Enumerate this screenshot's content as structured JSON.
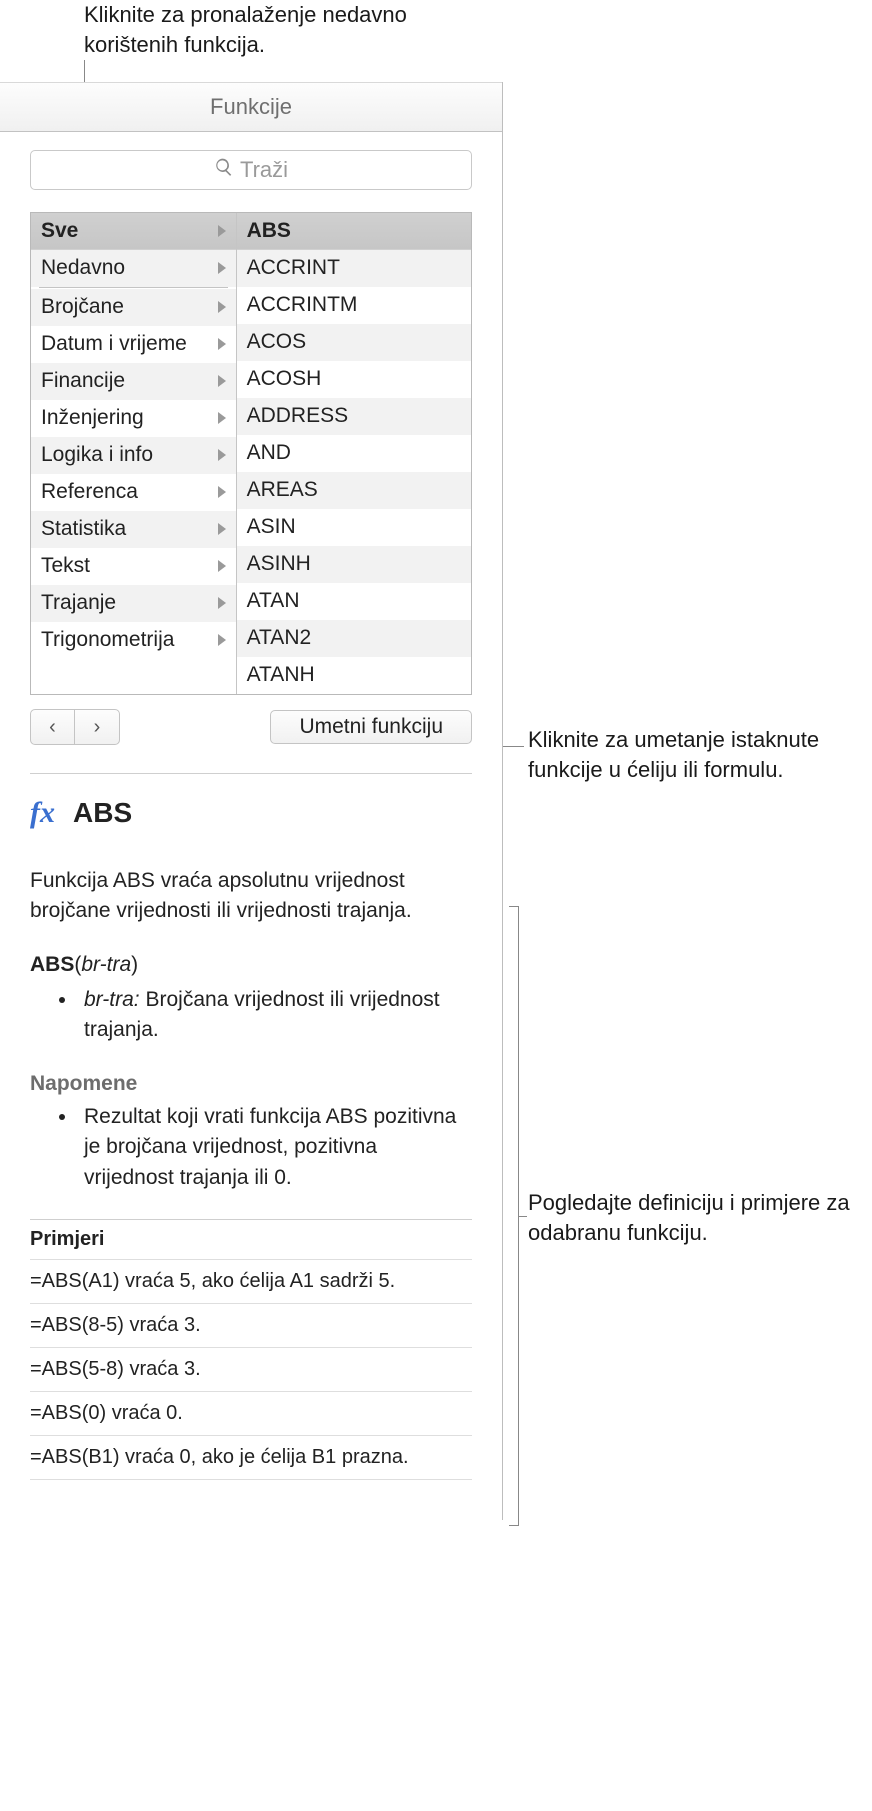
{
  "callouts": {
    "recent": "Kliknite za pronalaženje nedavno korištenih funkcija.",
    "insert": "Kliknite za umetanje istaknute funkcije u ćeliju ili formulu.",
    "definition": "Pogledajte definiciju i primjere za odabranu funkciju."
  },
  "header": {
    "title": "Funkcije"
  },
  "search": {
    "placeholder": "Traži"
  },
  "categories": [
    {
      "label": "Sve",
      "selected": true
    },
    {
      "label": "Nedavno"
    },
    {
      "separator": true
    },
    {
      "label": "Brojčane"
    },
    {
      "label": "Datum i vrijeme"
    },
    {
      "label": "Financije"
    },
    {
      "label": "Inženjering"
    },
    {
      "label": "Logika i info"
    },
    {
      "label": "Referenca"
    },
    {
      "label": "Statistika"
    },
    {
      "label": "Tekst"
    },
    {
      "label": "Trajanje"
    },
    {
      "label": "Trigonometrija"
    }
  ],
  "functions": [
    {
      "label": "ABS",
      "selected": true
    },
    {
      "label": "ACCRINT"
    },
    {
      "label": "ACCRINTM"
    },
    {
      "label": "ACOS"
    },
    {
      "label": "ACOSH"
    },
    {
      "label": "ADDRESS"
    },
    {
      "label": "AND"
    },
    {
      "label": "AREAS"
    },
    {
      "label": "ASIN"
    },
    {
      "label": "ASINH"
    },
    {
      "label": "ATAN"
    },
    {
      "label": "ATAN2"
    },
    {
      "label": "ATANH"
    }
  ],
  "toolbar": {
    "back_label": "‹",
    "forward_label": "›",
    "insert_label": "Umetni funkciju"
  },
  "detail": {
    "fx_symbol": "fx",
    "name": "ABS",
    "summary": "Funkcija ABS vraća apsolutnu vrijednost brojčane vrijednosti ili vrijednosti trajanja.",
    "syntax_name": "ABS",
    "syntax_args": "br-tra",
    "arg_name": "br-tra:",
    "arg_desc": "Brojčana vrijednost ili vrijednost trajanja.",
    "notes_heading": "Napomene",
    "note1": "Rezultat koji vrati funkcija ABS pozitivna je brojčana vrijednost, pozitivna vrijednost trajanja ili 0.",
    "examples_heading": "Primjeri",
    "examples": [
      "=ABS(A1) vraća 5, ako ćelija A1 sadrži 5.",
      "=ABS(8-5) vraća 3.",
      "=ABS(5-8) vraća 3.",
      "=ABS(0) vraća 0.",
      "=ABS(B1) vraća 0, ako je ćelija B1 prazna."
    ]
  }
}
